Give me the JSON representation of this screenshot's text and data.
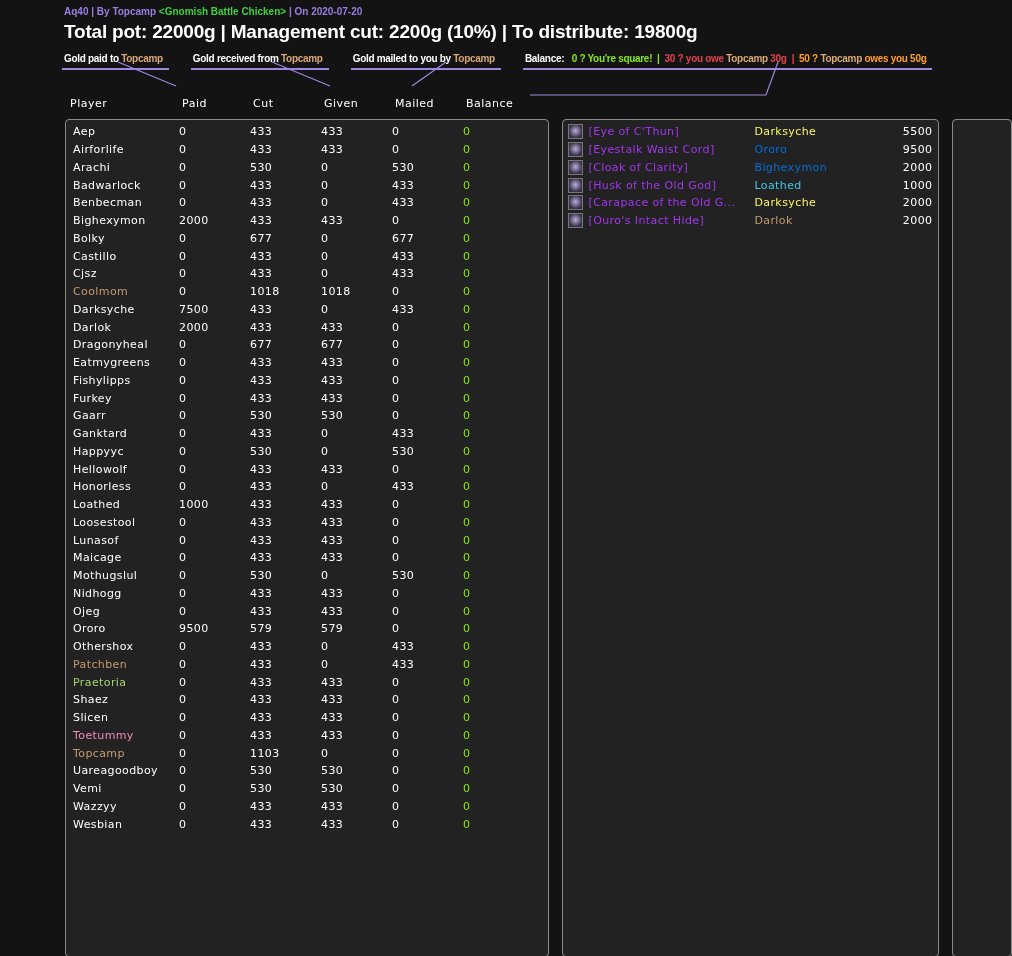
{
  "raid_line": [
    {
      "text": "Aq40 | By ",
      "kind": "plain"
    },
    {
      "text": "Topcamp",
      "kind": "plain"
    },
    {
      "text": " <Gnomish Battle Chicken> ",
      "kind": "guild"
    },
    {
      "text": "| On 2020-07-20",
      "kind": "plain"
    }
  ],
  "title": "Total pot: 22000g | Management cut: 2200g (10%) | To distribute: 19800g",
  "legends": [
    {
      "parts": [
        {
          "text": "Gold paid to ",
          "kind": "label"
        },
        {
          "text": "Topcamp",
          "kind": "name"
        }
      ]
    },
    {
      "parts": [
        {
          "text": "Gold received from ",
          "kind": "label"
        },
        {
          "text": "Topcamp",
          "kind": "name"
        }
      ]
    },
    {
      "parts": [
        {
          "text": "Gold mailed to you by ",
          "kind": "label"
        },
        {
          "text": "Topcamp",
          "kind": "name"
        }
      ]
    },
    {
      "parts": [
        {
          "text": "Balance:   ",
          "kind": "label"
        },
        {
          "text": "0 ? You're square!  |  ",
          "kind": "even"
        },
        {
          "text": "30 ? you owe ",
          "kind": "owe"
        },
        {
          "text": "Topcamp",
          "kind": "name"
        },
        {
          "text": " 30g  |  ",
          "kind": "owe"
        },
        {
          "text": "50 ? ",
          "kind": "owed"
        },
        {
          "text": "Topcamp",
          "kind": "name"
        },
        {
          "text": " owes you 50g",
          "kind": "owed"
        }
      ]
    }
  ],
  "columns": [
    "Player",
    "Paid",
    "Cut",
    "Given",
    "Mailed",
    "Balance"
  ],
  "players": [
    {
      "name": "Aep",
      "color": "#ffffff",
      "paid": "0",
      "cut": "433",
      "given": "433",
      "mailed": "0",
      "balance": "0"
    },
    {
      "name": "Airforlife",
      "color": "#ffffff",
      "paid": "0",
      "cut": "433",
      "given": "433",
      "mailed": "0",
      "balance": "0"
    },
    {
      "name": "Arachi",
      "color": "#ffffff",
      "paid": "0",
      "cut": "530",
      "given": "0",
      "mailed": "530",
      "balance": "0"
    },
    {
      "name": "Badwarlock",
      "color": "#ffffff",
      "paid": "0",
      "cut": "433",
      "given": "0",
      "mailed": "433",
      "balance": "0"
    },
    {
      "name": "Benbecman",
      "color": "#ffffff",
      "paid": "0",
      "cut": "433",
      "given": "0",
      "mailed": "433",
      "balance": "0"
    },
    {
      "name": "Bighexymon",
      "color": "#ffffff",
      "paid": "2000",
      "cut": "433",
      "given": "433",
      "mailed": "0",
      "balance": "0"
    },
    {
      "name": "Bolky",
      "color": "#ffffff",
      "paid": "0",
      "cut": "677",
      "given": "0",
      "mailed": "677",
      "balance": "0"
    },
    {
      "name": "Castillo",
      "color": "#ffffff",
      "paid": "0",
      "cut": "433",
      "given": "0",
      "mailed": "433",
      "balance": "0"
    },
    {
      "name": "Cjsz",
      "color": "#ffffff",
      "paid": "0",
      "cut": "433",
      "given": "0",
      "mailed": "433",
      "balance": "0"
    },
    {
      "name": "Coolmom",
      "color": "#c69b6d",
      "paid": "0",
      "cut": "1018",
      "given": "1018",
      "mailed": "0",
      "balance": "0"
    },
    {
      "name": "Darksyche",
      "color": "#ffffff",
      "paid": "7500",
      "cut": "433",
      "given": "0",
      "mailed": "433",
      "balance": "0"
    },
    {
      "name": "Darlok",
      "color": "#ffffff",
      "paid": "2000",
      "cut": "433",
      "given": "433",
      "mailed": "0",
      "balance": "0"
    },
    {
      "name": "Dragonyheal",
      "color": "#ffffff",
      "paid": "0",
      "cut": "677",
      "given": "677",
      "mailed": "0",
      "balance": "0"
    },
    {
      "name": "Eatmygreens",
      "color": "#ffffff",
      "paid": "0",
      "cut": "433",
      "given": "433",
      "mailed": "0",
      "balance": "0"
    },
    {
      "name": "Fishylipps",
      "color": "#ffffff",
      "paid": "0",
      "cut": "433",
      "given": "433",
      "mailed": "0",
      "balance": "0"
    },
    {
      "name": "Furkey",
      "color": "#ffffff",
      "paid": "0",
      "cut": "433",
      "given": "433",
      "mailed": "0",
      "balance": "0"
    },
    {
      "name": "Gaarr",
      "color": "#ffffff",
      "paid": "0",
      "cut": "530",
      "given": "530",
      "mailed": "0",
      "balance": "0"
    },
    {
      "name": "Ganktard",
      "color": "#ffffff",
      "paid": "0",
      "cut": "433",
      "given": "0",
      "mailed": "433",
      "balance": "0"
    },
    {
      "name": "Happyyc",
      "color": "#ffffff",
      "paid": "0",
      "cut": "530",
      "given": "0",
      "mailed": "530",
      "balance": "0"
    },
    {
      "name": "Hellowolf",
      "color": "#ffffff",
      "paid": "0",
      "cut": "433",
      "given": "433",
      "mailed": "0",
      "balance": "0"
    },
    {
      "name": "Honorless",
      "color": "#ffffff",
      "paid": "0",
      "cut": "433",
      "given": "0",
      "mailed": "433",
      "balance": "0"
    },
    {
      "name": "Loathed",
      "color": "#ffffff",
      "paid": "1000",
      "cut": "433",
      "given": "433",
      "mailed": "0",
      "balance": "0"
    },
    {
      "name": "Loosestool",
      "color": "#ffffff",
      "paid": "0",
      "cut": "433",
      "given": "433",
      "mailed": "0",
      "balance": "0"
    },
    {
      "name": "Lunasof",
      "color": "#ffffff",
      "paid": "0",
      "cut": "433",
      "given": "433",
      "mailed": "0",
      "balance": "0"
    },
    {
      "name": "Maicage",
      "color": "#ffffff",
      "paid": "0",
      "cut": "433",
      "given": "433",
      "mailed": "0",
      "balance": "0"
    },
    {
      "name": "Mothugslul",
      "color": "#ffffff",
      "paid": "0",
      "cut": "530",
      "given": "0",
      "mailed": "530",
      "balance": "0"
    },
    {
      "name": "Nidhogg",
      "color": "#ffffff",
      "paid": "0",
      "cut": "433",
      "given": "433",
      "mailed": "0",
      "balance": "0"
    },
    {
      "name": "Ojeg",
      "color": "#ffffff",
      "paid": "0",
      "cut": "433",
      "given": "433",
      "mailed": "0",
      "balance": "0"
    },
    {
      "name": "Ororo",
      "color": "#ffffff",
      "paid": "9500",
      "cut": "579",
      "given": "579",
      "mailed": "0",
      "balance": "0"
    },
    {
      "name": "Othershox",
      "color": "#ffffff",
      "paid": "0",
      "cut": "433",
      "given": "0",
      "mailed": "433",
      "balance": "0"
    },
    {
      "name": "Patchben",
      "color": "#c69b6d",
      "paid": "0",
      "cut": "433",
      "given": "0",
      "mailed": "433",
      "balance": "0"
    },
    {
      "name": "Praetoria",
      "color": "#aad372",
      "paid": "0",
      "cut": "433",
      "given": "433",
      "mailed": "0",
      "balance": "0"
    },
    {
      "name": "Shaez",
      "color": "#ffffff",
      "paid": "0",
      "cut": "433",
      "given": "433",
      "mailed": "0",
      "balance": "0"
    },
    {
      "name": "Slicen",
      "color": "#ffffff",
      "paid": "0",
      "cut": "433",
      "given": "433",
      "mailed": "0",
      "balance": "0"
    },
    {
      "name": "Toetummy",
      "color": "#f48cba",
      "paid": "0",
      "cut": "433",
      "given": "433",
      "mailed": "0",
      "balance": "0"
    },
    {
      "name": "Topcamp",
      "color": "#c69b6d",
      "paid": "0",
      "cut": "1103",
      "given": "0",
      "mailed": "0",
      "balance": "0"
    },
    {
      "name": "Uareagoodboy",
      "color": "#ffffff",
      "paid": "0",
      "cut": "530",
      "given": "530",
      "mailed": "0",
      "balance": "0"
    },
    {
      "name": "Vemi",
      "color": "#ffffff",
      "paid": "0",
      "cut": "530",
      "given": "530",
      "mailed": "0",
      "balance": "0"
    },
    {
      "name": "Wazzyy",
      "color": "#ffffff",
      "paid": "0",
      "cut": "433",
      "given": "433",
      "mailed": "0",
      "balance": "0"
    },
    {
      "name": "Wesbian",
      "color": "#ffffff",
      "paid": "0",
      "cut": "433",
      "given": "433",
      "mailed": "0",
      "balance": "0"
    }
  ],
  "items": [
    {
      "name": "[Eye of C'Thun]",
      "winner": "Darksyche",
      "color": "#fff468",
      "price": "5500"
    },
    {
      "name": "[Eyestalk Waist Cord]",
      "winner": "Ororo",
      "color": "#0070dd",
      "price": "9500"
    },
    {
      "name": "[Cloak of Clarity]",
      "winner": "Bighexymon",
      "color": "#0070dd",
      "price": "2000"
    },
    {
      "name": "[Husk of the Old God]",
      "winner": "Loathed",
      "color": "#3fc7eb",
      "price": "1000"
    },
    {
      "name": "[Carapace of the Old G...",
      "winner": "Darksyche",
      "color": "#fff468",
      "price": "2000"
    },
    {
      "name": "[Ouro's Intact Hide]",
      "winner": "Darlok",
      "color": "#c69b6d",
      "price": "2000"
    }
  ]
}
